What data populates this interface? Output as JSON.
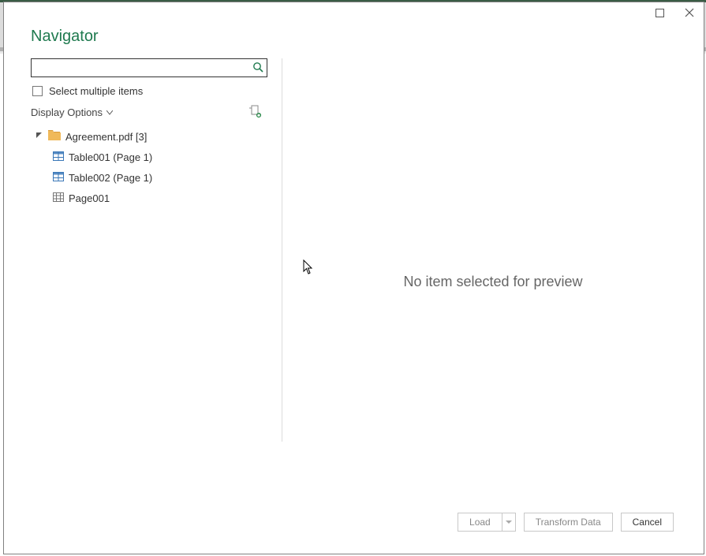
{
  "dialog": {
    "title": "Navigator",
    "search_placeholder": "",
    "select_multiple_label": "Select multiple items",
    "display_options_label": "Display Options"
  },
  "tree": {
    "root_label": "Agreement.pdf [3]",
    "items": [
      {
        "label": "Table001 (Page 1)",
        "type": "table"
      },
      {
        "label": "Table002 (Page 1)",
        "type": "table"
      },
      {
        "label": "Page001",
        "type": "page"
      }
    ]
  },
  "preview": {
    "empty_message": "No item selected for preview"
  },
  "footer": {
    "load_label": "Load",
    "transform_label": "Transform Data",
    "cancel_label": "Cancel"
  }
}
